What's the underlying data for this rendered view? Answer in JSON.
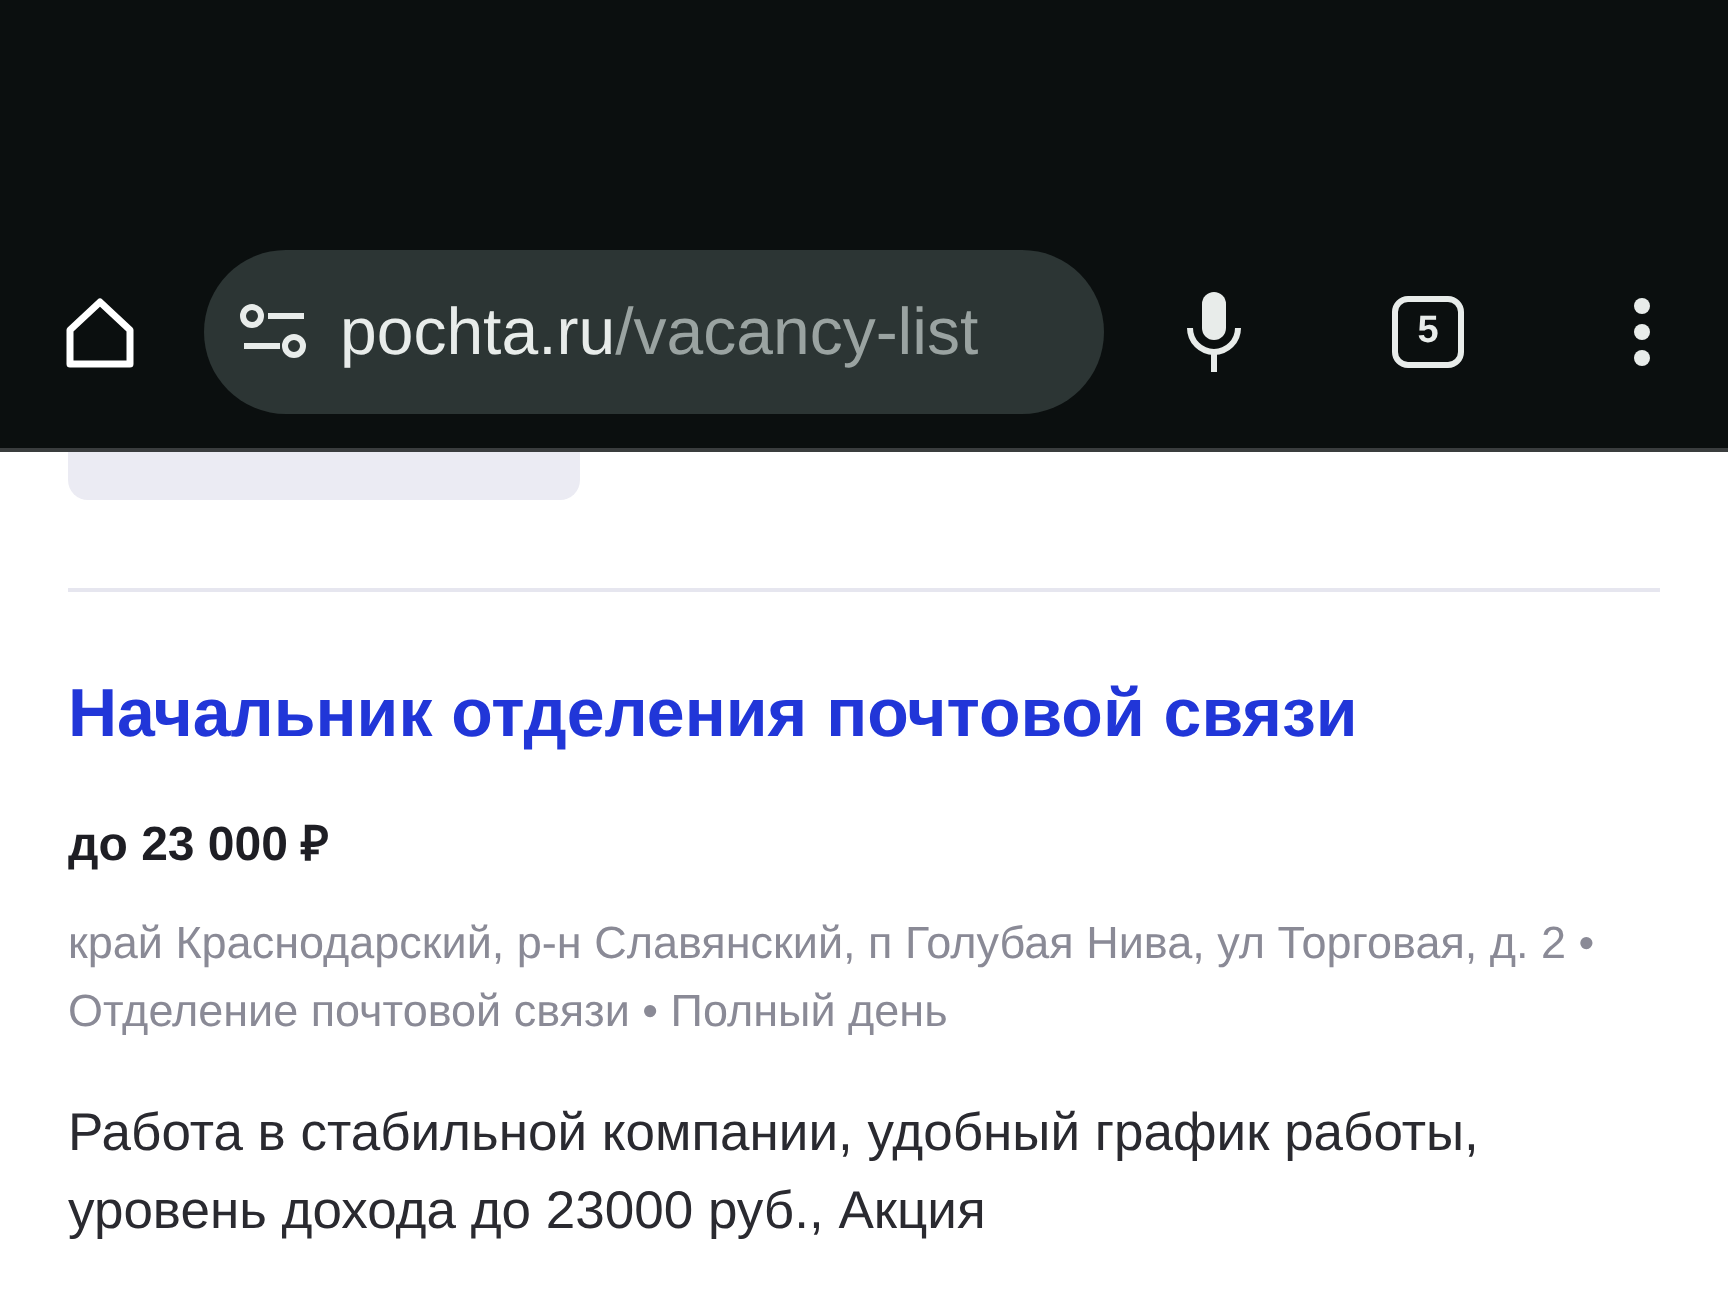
{
  "browser": {
    "url_host": "pochta.ru",
    "url_path": "/vacancy-list",
    "tab_count": "5"
  },
  "vacancy": {
    "title": "Начальник отделения почтовой связи",
    "salary": "до 23 000 ₽",
    "details": "край Краснодарский, р-н Славянский, п Голубая Нива, ул Торговая, д. 2 • Отделение почтовой связи • Полный день",
    "description": "Работа в стабильной компании, удобный график работы, уровень дохода до 23000 руб., Акция"
  }
}
